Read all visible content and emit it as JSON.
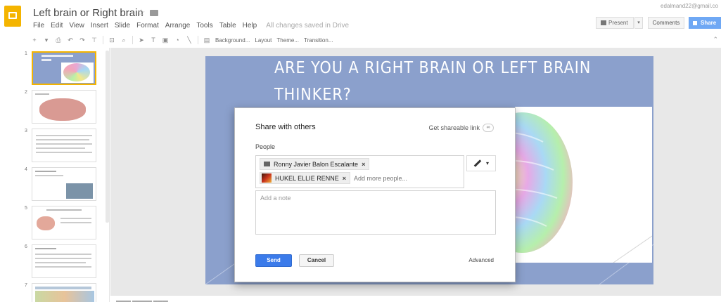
{
  "app": {
    "title": "Left brain or Right brain",
    "save_status": "All changes saved in Drive",
    "user_email": "edalmand22@gmail.co",
    "colors": {
      "logo": "#f4b400",
      "share": "#6fa8f4",
      "send": "#3b7bea",
      "slide_bg": "#8ba0cc"
    }
  },
  "menu": [
    "File",
    "Edit",
    "View",
    "Insert",
    "Slide",
    "Format",
    "Arrange",
    "Tools",
    "Table",
    "Help"
  ],
  "header_buttons": {
    "present": "Present",
    "comments": "Comments",
    "share": "Share"
  },
  "toolbar": {
    "background": "Background...",
    "layout": "Layout",
    "theme": "Theme...",
    "transition": "Transition...",
    "icons": [
      "plus-icon",
      "print-icon",
      "undo-icon",
      "redo-icon",
      "paint-format-icon",
      "zoom-fit-icon",
      "zoom-icon",
      "select-icon",
      "textbox-icon",
      "image-icon",
      "shape-icon",
      "line-icon",
      "comment-icon"
    ]
  },
  "filmstrip": {
    "slides": [
      {
        "num": "1",
        "selected": true
      },
      {
        "num": "2"
      },
      {
        "num": "3"
      },
      {
        "num": "4"
      },
      {
        "num": "5"
      },
      {
        "num": "6"
      },
      {
        "num": "7"
      }
    ]
  },
  "slide": {
    "title_line1": "ARE YOU A RIGHT BRAIN OR LEFT BRAIN",
    "title_line2": "THINKER?"
  },
  "dialog": {
    "title": "Share with others",
    "shareable_link": "Get shareable link",
    "people_label": "People",
    "recipients": [
      {
        "name": "Ronny Javier Balon Escalante",
        "icon": "mail-icon"
      },
      {
        "name": "HUKEL ELLIE RENNE",
        "icon": "avatar"
      }
    ],
    "add_placeholder": "Add more people...",
    "note_placeholder": "Add a note",
    "send": "Send",
    "cancel": "Cancel",
    "advanced": "Advanced"
  }
}
